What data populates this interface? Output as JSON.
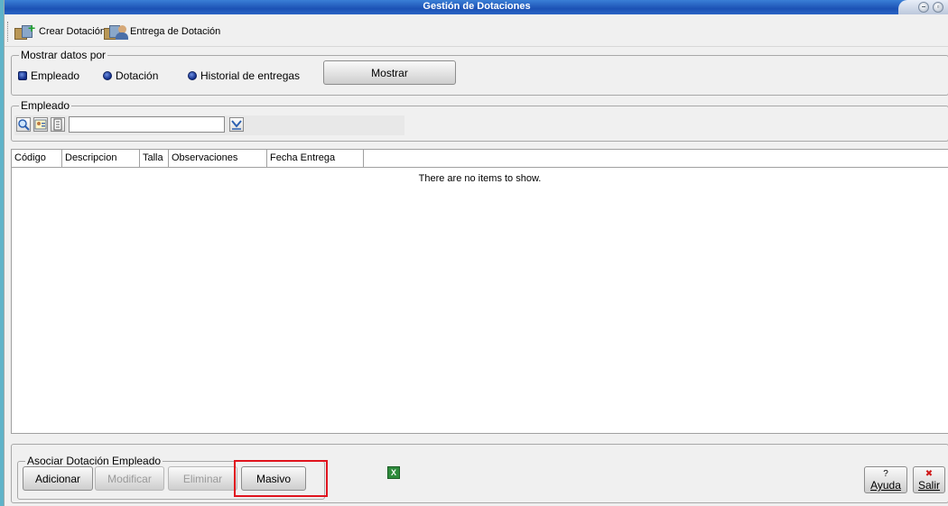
{
  "window": {
    "title": "Gestión de Dotaciones"
  },
  "toolbar": {
    "crear_label": "Crear Dotación",
    "entrega_label": "Entrega de Dotación"
  },
  "mostrar": {
    "legend": "Mostrar datos por",
    "options": [
      {
        "label": "Empleado"
      },
      {
        "label": "Dotación"
      },
      {
        "label": "Historial de entregas"
      }
    ],
    "button_label": "Mostrar"
  },
  "empleado": {
    "legend": "Empleado",
    "value": ""
  },
  "table": {
    "columns": [
      "Código",
      "Descripcion",
      "Talla",
      "Observaciones",
      "Fecha Entrega"
    ],
    "empty_message": "There are no items to show."
  },
  "asociar": {
    "legend": "Asociar Dotación Empleado",
    "adicionar": "Adicionar",
    "modificar": "Modificar",
    "eliminar": "Eliminar",
    "masivo": "Masivo"
  },
  "export": {
    "icon_letter": "X"
  },
  "footer": {
    "ayuda": "Ayuda",
    "salir": "Salir"
  }
}
